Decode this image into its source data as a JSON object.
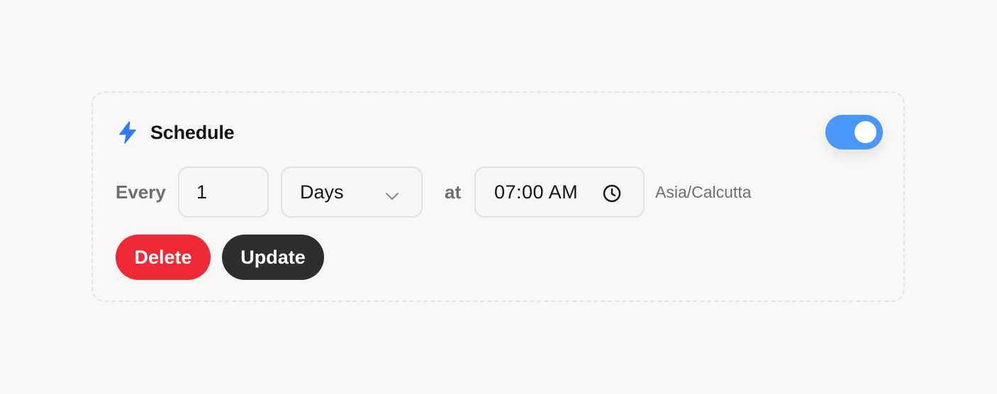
{
  "schedule": {
    "title": "Schedule",
    "enabled": true,
    "every_label": "Every",
    "interval_value": "1",
    "unit_selected": "Days",
    "at_label": "at",
    "time_value": "07:00 AM",
    "timezone": "Asia/Calcutta",
    "delete_label": "Delete",
    "update_label": "Update"
  },
  "icons": {
    "header": "lightning-bolt-icon",
    "unit_dropdown": "chevron-down-icon",
    "time_picker": "clock-icon"
  },
  "colors": {
    "accent": "#4b97f7",
    "bolt": "#2f7cf6",
    "delete": "#ef2a36",
    "update": "#2e2e2e",
    "background": "#f8f7f5"
  }
}
